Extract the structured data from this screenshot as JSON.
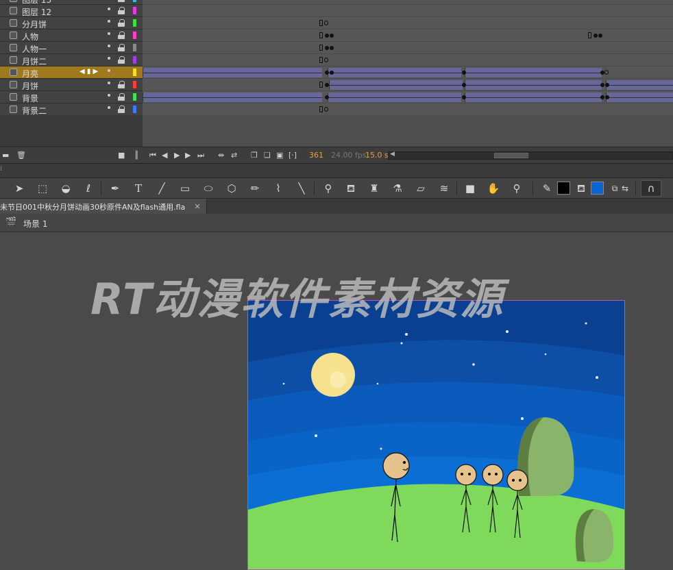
{
  "timeline": {
    "layers": [
      {
        "name": "图层 13",
        "color": "#27c2e4"
      },
      {
        "name": "图层 12",
        "color": "#e838e8"
      },
      {
        "name": "分月饼",
        "color": "#3be23b"
      },
      {
        "name": "人物",
        "color": "#ff3cc8"
      },
      {
        "name": "人物一",
        "color": "#8a8a8a"
      },
      {
        "name": "月饼二",
        "color": "#a03ce8"
      },
      {
        "name": "月亮",
        "color": "#f0e020",
        "selected": true
      },
      {
        "name": "月饼",
        "color": "#ff3c3c"
      },
      {
        "name": "背景",
        "color": "#3ce25a"
      },
      {
        "name": "背景二",
        "color": "#3c7aff"
      }
    ],
    "current_frame": "361",
    "fps": "24.00 fps",
    "time": "15.0 s"
  },
  "document": {
    "tab_title": "未节日001中秋分月饼动画30秒原件AN及flash通用.fla",
    "close_glyph": "×"
  },
  "scene": {
    "label": "场景 1"
  },
  "watermark": "RT动漫软件素材资源",
  "colors": {
    "selected_layer": "#a0781e",
    "tween": "#67679a",
    "frame_number": "#e8a33a",
    "sky_top": "#0b3f8f",
    "grass": "#7fd95b",
    "moon": "#f6e28c",
    "fill_swatch": "#0a64d4",
    "stroke_swatch": "#000000"
  }
}
